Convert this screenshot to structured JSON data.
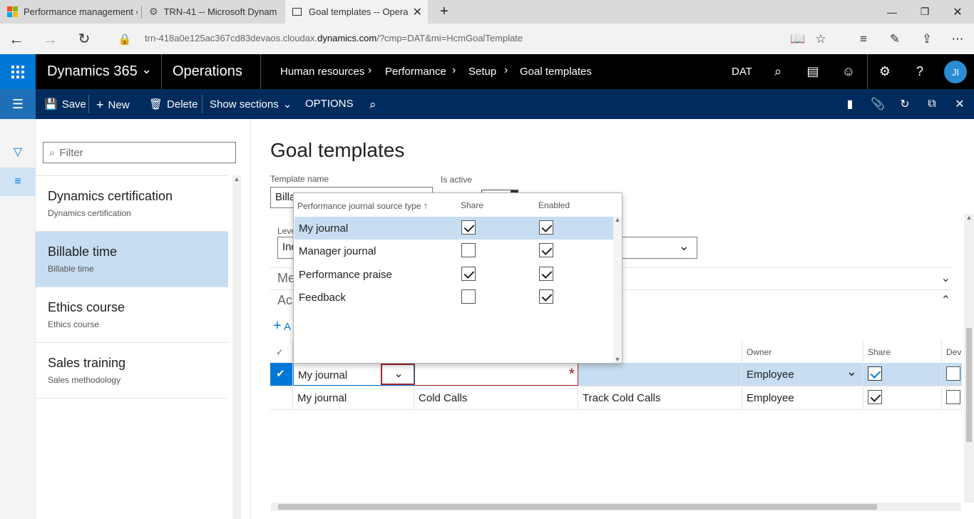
{
  "browser": {
    "tabs": [
      {
        "title": "Performance management ‹"
      },
      {
        "title": "TRN-41 -- Microsoft Dynam"
      },
      {
        "title": "Goal templates -- Opera"
      }
    ],
    "url_pre": "trn-418a0e125ac367cd83devaos.cloudax.",
    "url_host": "dynamics.com",
    "url_post": "/?cmp=DAT&mi=HcmGoalTemplate"
  },
  "navbar": {
    "brand": "Dynamics 365",
    "app": "Operations",
    "breadcrumb": [
      "Human resources",
      "Performance",
      "Setup",
      "Goal templates"
    ],
    "company": "DAT",
    "user_initials": "JI"
  },
  "actions": {
    "save": "Save",
    "new": "New",
    "delete": "Delete",
    "show_sections": "Show sections",
    "options": "OPTIONS"
  },
  "listpane": {
    "filter_placeholder": "Filter",
    "items": [
      {
        "title": "Dynamics certification",
        "subtitle": "Dynamics certification"
      },
      {
        "title": "Billable time",
        "subtitle": "Billable time"
      },
      {
        "title": "Ethics course",
        "subtitle": "Ethics course"
      },
      {
        "title": "Sales training",
        "subtitle": "Sales methodology"
      }
    ]
  },
  "form": {
    "title": "Goal templates",
    "template_name_label": "Template name",
    "template_name_value": "Billa",
    "is_active_label": "Is active",
    "level_label": "Leve",
    "level_value": "Ind",
    "section1": "Me",
    "section2": "Ac",
    "add_label": "A"
  },
  "grid": {
    "headers": {
      "description": "n",
      "owner": "Owner",
      "share": "Share",
      "dev": "Dev"
    },
    "rows": [
      {
        "type": "My journal",
        "goal": "",
        "description": "",
        "owner": "Employee",
        "share": true,
        "selected": true
      },
      {
        "type": "My journal",
        "goal": "Cold Calls",
        "description": "Track Cold Calls",
        "owner": "Employee",
        "share": true,
        "selected": false
      }
    ]
  },
  "flyout": {
    "headers": {
      "type": "Performance journal source type",
      "share": "Share",
      "enabled": "Enabled"
    },
    "rows": [
      {
        "name": "My journal",
        "share": true,
        "enabled": true,
        "selected": true
      },
      {
        "name": "Manager journal",
        "share": false,
        "enabled": true,
        "selected": false
      },
      {
        "name": "Performance praise",
        "share": true,
        "enabled": true,
        "selected": false
      },
      {
        "name": "Feedback",
        "share": false,
        "enabled": true,
        "selected": false
      }
    ]
  },
  "colors": {
    "accent": "#0078d7",
    "actionpane": "#002b5c",
    "selected": "#c7ddf1",
    "required": "#a4262c"
  }
}
